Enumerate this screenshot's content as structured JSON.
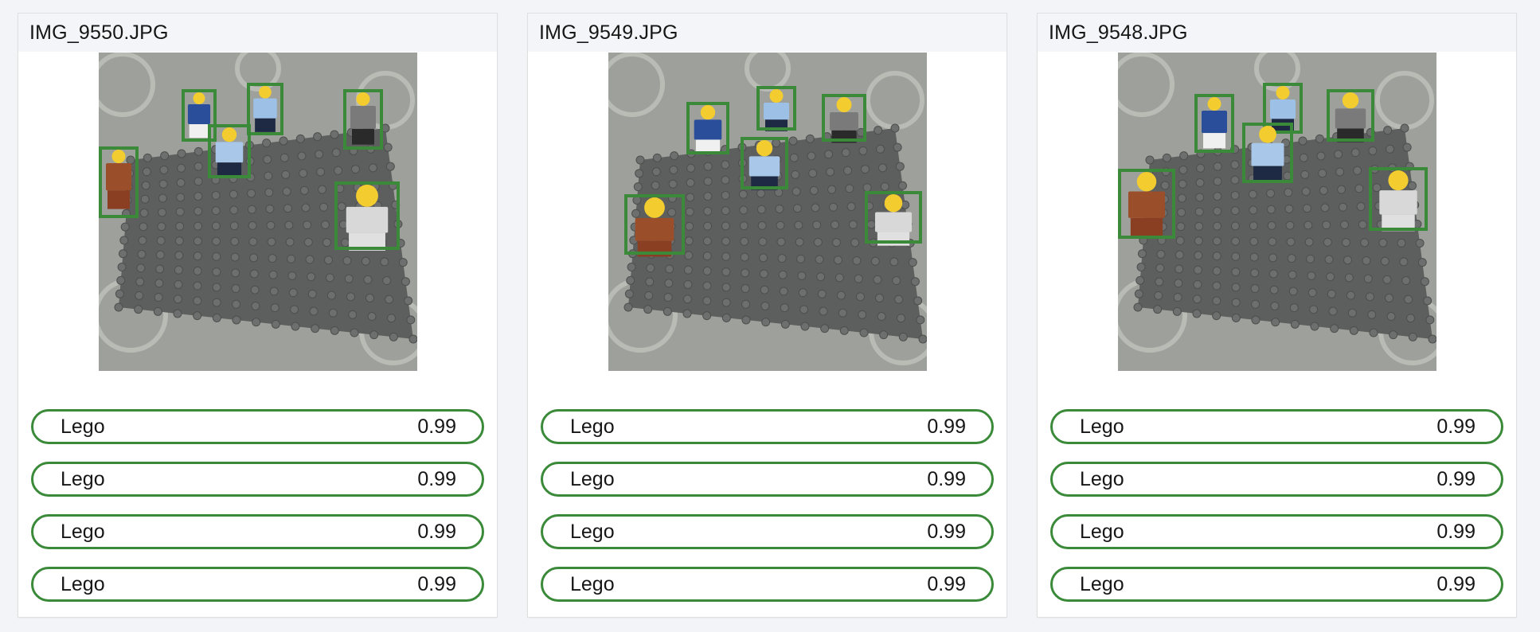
{
  "accent_color": "#3a8a3a",
  "cards": [
    {
      "filename": "IMG_9550.JPG",
      "image": "lego-minifigures-photo",
      "results": [
        {
          "label": "Lego",
          "score": "0.99"
        },
        {
          "label": "Lego",
          "score": "0.99"
        },
        {
          "label": "Lego",
          "score": "0.99"
        },
        {
          "label": "Lego",
          "score": "0.99"
        }
      ]
    },
    {
      "filename": "IMG_9549.JPG",
      "image": "lego-minifigures-photo",
      "results": [
        {
          "label": "Lego",
          "score": "0.99"
        },
        {
          "label": "Lego",
          "score": "0.99"
        },
        {
          "label": "Lego",
          "score": "0.99"
        },
        {
          "label": "Lego",
          "score": "0.99"
        }
      ]
    },
    {
      "filename": "IMG_9548.JPG",
      "image": "lego-minifigures-photo",
      "results": [
        {
          "label": "Lego",
          "score": "0.99"
        },
        {
          "label": "Lego",
          "score": "0.99"
        },
        {
          "label": "Lego",
          "score": "0.99"
        },
        {
          "label": "Lego",
          "score": "0.99"
        }
      ]
    }
  ]
}
